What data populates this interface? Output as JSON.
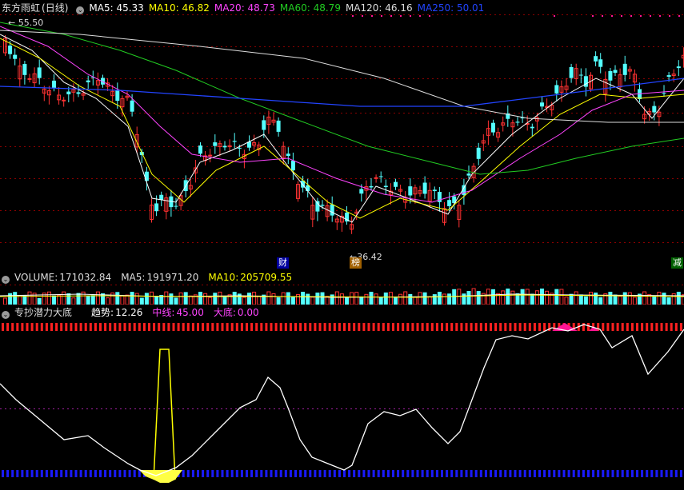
{
  "main": {
    "stock_name": "东方雨虹",
    "period": "(日线)",
    "ma": [
      {
        "label": "MA5:",
        "value": "45.33",
        "color": "#ffffff"
      },
      {
        "label": "MA10:",
        "value": "46.82",
        "color": "#ffff00"
      },
      {
        "label": "MA20:",
        "value": "48.73",
        "color": "#ff44ff"
      },
      {
        "label": "MA60:",
        "value": "48.79",
        "color": "#22cc22"
      },
      {
        "label": "MA120:",
        "value": "46.16",
        "color": "#dddddd"
      },
      {
        "label": "MA250:",
        "value": "50.01",
        "color": "#2244ff"
      }
    ],
    "high_label": "55.50",
    "low_label": "36.42",
    "tags": {
      "cai": "财",
      "bang": "榜",
      "jian": "减"
    }
  },
  "volume": {
    "label": "VOLUME:",
    "value": "171032.84",
    "ma5_label": "MA5:",
    "ma5_value": "191971.20",
    "ma10_label": "MA10:",
    "ma10_value": "205709.55"
  },
  "indicator": {
    "name": "专抄潜力大底",
    "trend_label": "趋势:",
    "trend_value": "12.26",
    "mid_label": "中线:",
    "mid_value": "45.00",
    "bottom_label": "大底:",
    "bottom_value": "0.00"
  },
  "colors": {
    "up": "#ff3232",
    "down": "#54ffff",
    "grid": "#8b0000",
    "pink": "#ff1493",
    "blue_bar": "#1a1aff"
  }
}
